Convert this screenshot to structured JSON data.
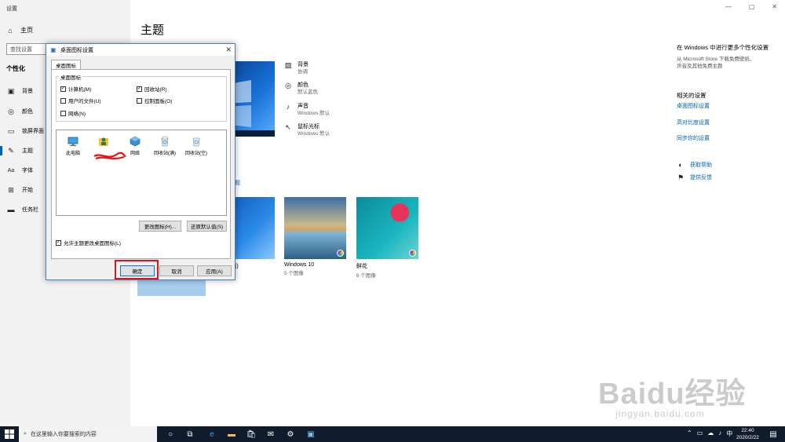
{
  "settings": {
    "window_title": "设置",
    "nav_home": "主页",
    "search_placeholder": "查找设置",
    "section": "个性化",
    "nav_items": [
      "背景",
      "颜色",
      "锁屏界面",
      "主题",
      "字体",
      "开始",
      "任务栏"
    ],
    "active_item": "主题"
  },
  "main": {
    "title": "主题",
    "props": [
      {
        "label": "背景",
        "value": "协调",
        "icon": "image-icon"
      },
      {
        "label": "颜色",
        "value": "默认蓝色",
        "icon": "palette-icon"
      },
      {
        "label": "声音",
        "value": "Windows 默认",
        "icon": "speaker-icon"
      },
      {
        "label": "鼠标光标",
        "value": "Windows 默认",
        "icon": "cursor-icon"
      }
    ],
    "link_fragment": "题",
    "themes": [
      {
        "name": "(浅色主题)",
        "count": ""
      },
      {
        "name": "Windows 10",
        "count": "5 个图像"
      },
      {
        "name": "鲜花",
        "count": "6 个图像"
      }
    ],
    "right": {
      "store_heading": "在 Windows 中进行更多个性化设置",
      "store_desc_1": "从 Microsoft Store 下载免费壁纸、",
      "store_desc_2": "声音及其他免费主题",
      "related_heading": "相关的设置",
      "related_links": [
        "桌面图标设置",
        "高对比度设置",
        "同步你的设置"
      ],
      "help": "获取帮助",
      "feedback": "提供反馈"
    }
  },
  "dialog": {
    "title": "桌面图标设置",
    "tab": "桌面图标",
    "group_label": "桌面图标",
    "checkboxes": [
      {
        "label": "计算机(M)",
        "checked": true
      },
      {
        "label": "回收站(R)",
        "checked": true
      },
      {
        "label": "用户的文件(U)",
        "checked": false
      },
      {
        "label": "控制面板(O)",
        "checked": false
      },
      {
        "label": "网络(N)",
        "checked": false
      }
    ],
    "icons": [
      "此电脑",
      "网络",
      "回收站(满)",
      "回收站(空)"
    ],
    "change_icon": "更改图标(H)...",
    "restore_default": "还原默认值(S)",
    "allow_themes": "允许主题更改桌面图标(L)",
    "ok": "确定",
    "cancel": "取消",
    "apply": "应用(A)"
  },
  "taskbar": {
    "search_placeholder": "在这里输入你要搜索的内容",
    "ime": "中",
    "time": "22:40",
    "date": "2020/2/22"
  },
  "watermark": {
    "main": "Baidu经验",
    "sub": "jingyan.baidu.com"
  }
}
